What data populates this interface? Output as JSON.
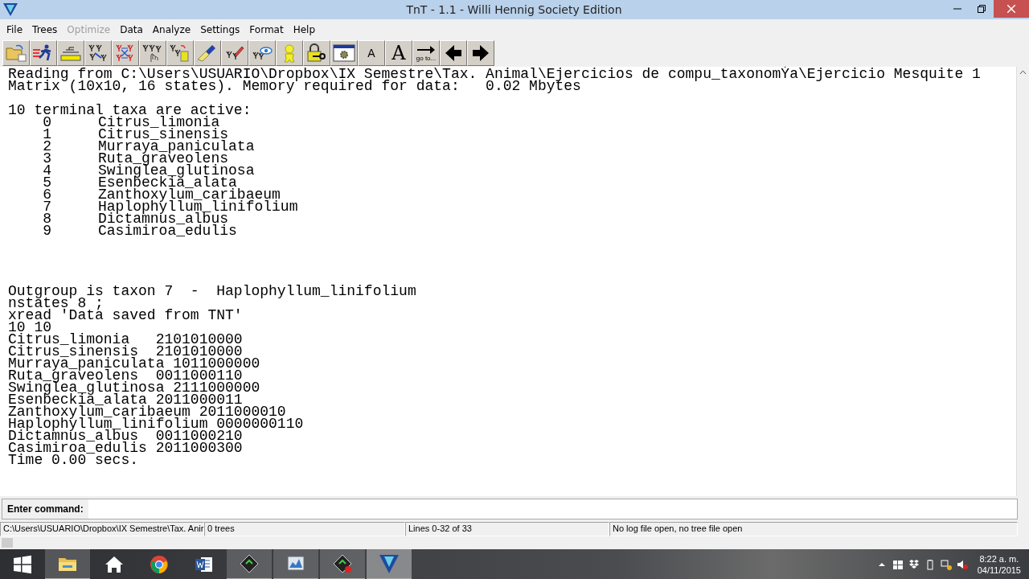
{
  "window": {
    "title": "TnT - 1.1 - Willi Hennig Society Edition"
  },
  "menu": [
    {
      "label": "File",
      "disabled": false
    },
    {
      "label": "Trees",
      "disabled": false
    },
    {
      "label": "Optimize",
      "disabled": true
    },
    {
      "label": "Data",
      "disabled": false
    },
    {
      "label": "Analyze",
      "disabled": false
    },
    {
      "label": "Settings",
      "disabled": false
    },
    {
      "label": "Format",
      "disabled": false
    },
    {
      "label": "Help",
      "disabled": false
    }
  ],
  "toolbar": {
    "small_font_label": "A",
    "large_font_label": "A",
    "goto_label": "go to..."
  },
  "output": {
    "header": [
      "Reading from C:\\Users\\USUARIO\\Dropbox\\IX Semestre\\Tax. Animal\\Ejercicios de compu_taxonomÝa\\Ejercicio Mesquite 1",
      "Matrix (10x10, 16 states). Memory required for data:   0.02 Mbytes"
    ],
    "taxa_title": "10 terminal taxa are active:",
    "taxa": [
      {
        "index": "0",
        "name": "Citrus_limonia"
      },
      {
        "index": "1",
        "name": "Citrus_sinensis"
      },
      {
        "index": "2",
        "name": "Murraya_paniculata"
      },
      {
        "index": "3",
        "name": "Ruta_graveolens"
      },
      {
        "index": "4",
        "name": "Swinglea_glutinosa"
      },
      {
        "index": "5",
        "name": "Esenbeckia_alata"
      },
      {
        "index": "6",
        "name": "Zanthoxylum_caribaeum"
      },
      {
        "index": "7",
        "name": "Haplophyllum_linifolium"
      },
      {
        "index": "8",
        "name": "Dictamnus_albus"
      },
      {
        "index": "9",
        "name": "Casimiroa_edulis"
      }
    ],
    "lines": [
      "Outgroup is taxon 7  -  Haplophyllum_linifolium",
      "nstates 8 ;",
      "xread 'Data saved from TNT'",
      "10 10",
      "Citrus_limonia   2101010000",
      "Citrus_sinensis  2101010000",
      "Murraya_paniculata 1011000000",
      "Ruta_graveolens  0011000110",
      "Swinglea_glutinosa 2111000000",
      "Esenbeckia_alata 2011000011",
      "Zanthoxylum_caribaeum 2011000010",
      "Haplophyllum_linifolium 0000000110",
      "Dictamnus_albus  0011000210",
      "Casimiroa_edulis 2011000300",
      "Time 0.00 secs."
    ]
  },
  "command": {
    "label": "Enter command:"
  },
  "status_bar": [
    "C:\\Users\\USUARIO\\Dropbox\\IX Semestre\\Tax. Anir",
    "0 trees",
    "Lines 0-32 of 33",
    "No log file open, no tree file open"
  ],
  "taskbar": {
    "time": "8:22 a. m.",
    "date": "04/11/2015"
  }
}
